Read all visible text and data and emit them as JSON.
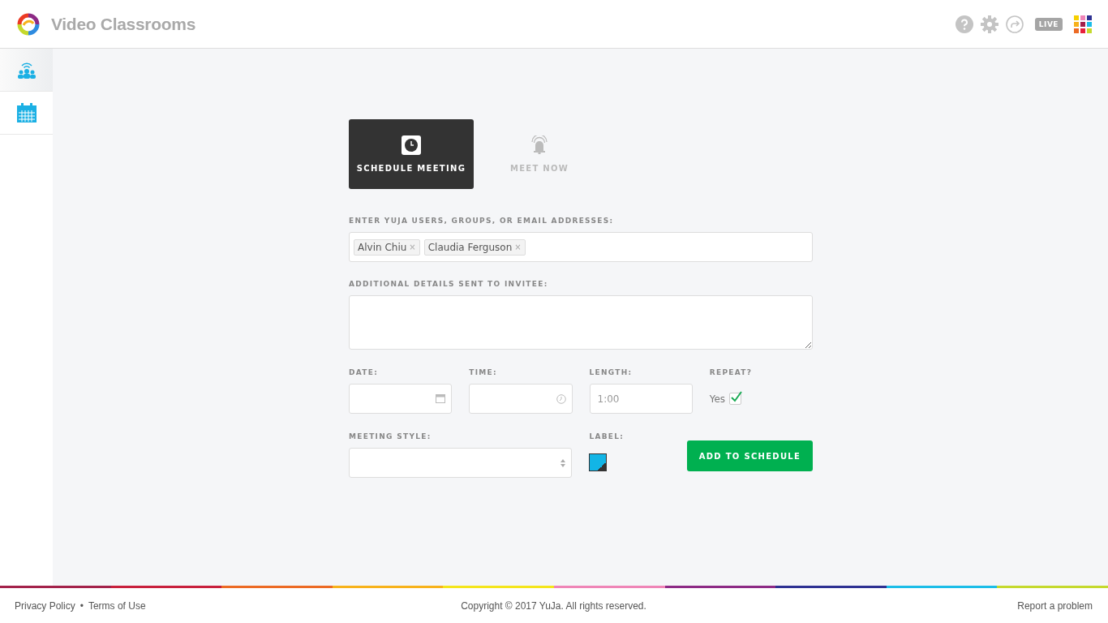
{
  "header": {
    "title": "Video Classrooms",
    "live_badge": "LIVE"
  },
  "sidebar": {
    "items": [
      {
        "kind": "classroom",
        "selected": true
      },
      {
        "kind": "calendar",
        "selected": false
      }
    ]
  },
  "tabs": [
    {
      "label": "SCHEDULE MEETING",
      "kind": "clock",
      "selected": true
    },
    {
      "label": "MEET NOW",
      "kind": "bell",
      "selected": false
    }
  ],
  "form": {
    "invitees": {
      "label": "ENTER YUJA USERS, GROUPS, OR EMAIL ADDRESSES:",
      "tokens": [
        "Alvin Chiu",
        "Claudia Ferguson"
      ],
      "remove_glyph": "×"
    },
    "details": {
      "label": "ADDITIONAL DETAILS SENT TO INVITEE:"
    },
    "date": {
      "label": "DATE:"
    },
    "time": {
      "label": "TIME:"
    },
    "length": {
      "label": "LENGTH:",
      "placeholder": "1:00"
    },
    "repeat": {
      "label": "REPEAT?",
      "option": "Yes",
      "checked": true
    },
    "meeting_style": {
      "label": "MEETING STYLE:"
    },
    "label": {
      "label": "LABEL:",
      "color": "#12b5e6"
    },
    "submit": "ADD TO SCHEDULE"
  },
  "footer": {
    "links": [
      "Privacy Policy",
      "Terms of Use"
    ],
    "separator": "•",
    "copyright": "Copyright © 2017 YuJa. All rights reserved.",
    "report": "Report a problem"
  }
}
